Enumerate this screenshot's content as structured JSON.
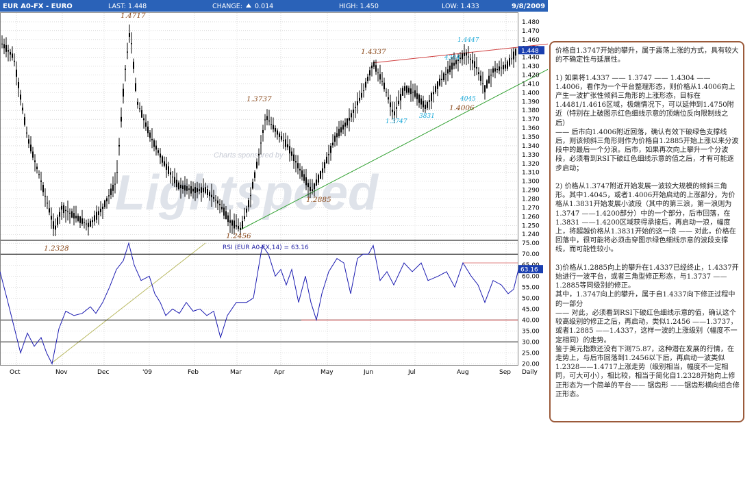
{
  "header": {
    "symbol": "EUR A0-FX - EURO",
    "last": "LAST: 1.448",
    "change_label": "CHANGE:",
    "change_value": "0.014",
    "high": "HIGH: 1.450",
    "low": "LOW: 1.433",
    "date": "9/8/2009"
  },
  "chart_data": [
    {
      "type": "candlestick",
      "title": "EUR A0-FX - EURO",
      "y_ticks": [
        "1.480",
        "1.470",
        "1.460",
        "1.450",
        "1.440",
        "1.430",
        "1.420",
        "1.410",
        "1.400",
        "1.390",
        "1.380",
        "1.370",
        "1.360",
        "1.350",
        "1.340",
        "1.330",
        "1.320",
        "1.310",
        "1.300",
        "1.290",
        "1.280",
        "1.270",
        "1.260",
        "1.250",
        "1.240"
      ],
      "ylim": [
        1.234,
        1.49
      ],
      "last_value_label": "1.448",
      "x_ticks": [
        "Oct",
        "Nov",
        "Dec",
        "'09",
        "Feb",
        "Mar",
        "Apr",
        "May",
        "Jun",
        "Jul",
        "Aug",
        "Sep",
        "Daily"
      ],
      "price_path": [
        [
          0,
          1.458
        ],
        [
          20,
          1.44
        ],
        [
          40,
          1.35
        ],
        [
          60,
          1.3
        ],
        [
          80,
          1.245
        ],
        [
          90,
          1.27
        ],
        [
          110,
          1.26
        ],
        [
          130,
          1.25
        ],
        [
          150,
          1.27
        ],
        [
          170,
          1.3
        ],
        [
          182,
          1.42
        ],
        [
          190,
          1.4717
        ],
        [
          200,
          1.39
        ],
        [
          220,
          1.35
        ],
        [
          240,
          1.32
        ],
        [
          260,
          1.295
        ],
        [
          280,
          1.29
        ],
        [
          300,
          1.29
        ],
        [
          320,
          1.275
        ],
        [
          335,
          1.255
        ],
        [
          352,
          1.2456
        ],
        [
          365,
          1.28
        ],
        [
          378,
          1.33
        ],
        [
          388,
          1.3737
        ],
        [
          400,
          1.36
        ],
        [
          420,
          1.34
        ],
        [
          440,
          1.31
        ],
        [
          455,
          1.2885
        ],
        [
          470,
          1.31
        ],
        [
          490,
          1.35
        ],
        [
          510,
          1.37
        ],
        [
          530,
          1.4
        ],
        [
          545,
          1.4337
        ],
        [
          560,
          1.41
        ],
        [
          575,
          1.3747
        ],
        [
          590,
          1.405
        ],
        [
          605,
          1.4
        ],
        [
          622,
          1.3831
        ],
        [
          640,
          1.41
        ],
        [
          660,
          1.43
        ],
        [
          680,
          1.4447
        ],
        [
          695,
          1.43
        ],
        [
          708,
          1.4045
        ],
        [
          720,
          1.425
        ],
        [
          740,
          1.43
        ],
        [
          755,
          1.448
        ]
      ],
      "annotations": [
        {
          "text": "1.4717",
          "style": "wave"
        },
        {
          "text": "1.3737",
          "style": "wave"
        },
        {
          "text": "1.4337",
          "style": "wave"
        },
        {
          "text": "1.4447",
          "style": "wave-b"
        },
        {
          "text": "4304",
          "style": "wave-b"
        },
        {
          "text": "1.4006",
          "style": "wave"
        },
        {
          "text": "4045",
          "style": "wave-b"
        },
        {
          "text": "3831",
          "style": "wave-b"
        },
        {
          "text": "1.3747",
          "style": "wave-b"
        },
        {
          "text": "1.2885",
          "style": "wave"
        },
        {
          "text": "1.2456",
          "style": "wave"
        },
        {
          "text": "1.2328",
          "style": "wave"
        }
      ],
      "watermark": [
        "Charts sponsored by",
        "Lightspeed"
      ],
      "trendlines": [
        {
          "color": "#d04040",
          "from": [
            545,
            1.4337
          ],
          "to": [
            800,
            1.455
          ]
        },
        {
          "color": "#30a030",
          "from": [
            352,
            1.2456
          ],
          "to": [
            800,
            1.4263
          ]
        }
      ]
    },
    {
      "type": "line",
      "title": "RSI (EUR A0-FX,14) = 63.16",
      "series": [
        {
          "name": "RSI (EUR A0-FX,14)",
          "color": "#1a1ab0"
        }
      ],
      "y_ticks": [
        "75.00",
        "70.00",
        "65.00",
        "60.00",
        "55.00",
        "50.00",
        "45.00",
        "40.00",
        "35.00",
        "30.00",
        "25.00",
        "20.00"
      ],
      "ylim": [
        19.5,
        76
      ],
      "last_value_label": "63.16",
      "rsi_path": [
        [
          0,
          62
        ],
        [
          10,
          50
        ],
        [
          22,
          35
        ],
        [
          30,
          25
        ],
        [
          40,
          34
        ],
        [
          50,
          28
        ],
        [
          60,
          32
        ],
        [
          68,
          25
        ],
        [
          76,
          20
        ],
        [
          86,
          36
        ],
        [
          96,
          44
        ],
        [
          108,
          42
        ],
        [
          120,
          43
        ],
        [
          132,
          46
        ],
        [
          140,
          43
        ],
        [
          150,
          48
        ],
        [
          160,
          55
        ],
        [
          170,
          63
        ],
        [
          180,
          67
        ],
        [
          188,
          75
        ],
        [
          196,
          65
        ],
        [
          206,
          58
        ],
        [
          218,
          60
        ],
        [
          226,
          52
        ],
        [
          234,
          48
        ],
        [
          242,
          42
        ],
        [
          252,
          45
        ],
        [
          262,
          43
        ],
        [
          272,
          48
        ],
        [
          282,
          44
        ],
        [
          292,
          45
        ],
        [
          302,
          42
        ],
        [
          312,
          44
        ],
        [
          322,
          32
        ],
        [
          332,
          42
        ],
        [
          345,
          48
        ],
        [
          360,
          48
        ],
        [
          370,
          50
        ],
        [
          383,
          74
        ],
        [
          392,
          70
        ],
        [
          402,
          60
        ],
        [
          410,
          63
        ],
        [
          418,
          56
        ],
        [
          426,
          63
        ],
        [
          436,
          48
        ],
        [
          446,
          60
        ],
        [
          454,
          48
        ],
        [
          462,
          40
        ],
        [
          470,
          52
        ],
        [
          480,
          62
        ],
        [
          492,
          68
        ],
        [
          502,
          66
        ],
        [
          512,
          52
        ],
        [
          522,
          68
        ],
        [
          530,
          70
        ],
        [
          538,
          70
        ],
        [
          545,
          74
        ],
        [
          555,
          58
        ],
        [
          565,
          62
        ],
        [
          575,
          56
        ],
        [
          590,
          66
        ],
        [
          602,
          62
        ],
        [
          615,
          66
        ],
        [
          625,
          58
        ],
        [
          640,
          60
        ],
        [
          652,
          62
        ],
        [
          664,
          55
        ],
        [
          676,
          66
        ],
        [
          688,
          60
        ],
        [
          698,
          56
        ],
        [
          708,
          48
        ],
        [
          720,
          58
        ],
        [
          732,
          56
        ],
        [
          742,
          52
        ],
        [
          750,
          54
        ],
        [
          757,
          63
        ]
      ],
      "hlines": [
        {
          "value": 70,
          "color": "#000000"
        },
        {
          "value": 40,
          "color": "#000000"
        },
        {
          "value": 30,
          "color": "#000000"
        },
        {
          "value": 40,
          "color": "#d04040",
          "x_from": 440
        },
        {
          "value": 66,
          "color": "#e08080",
          "x_from": 676
        }
      ]
    }
  ],
  "notes": {
    "text": "价格自1.3747开始的攀升，属于震荡上涨的方式，具有较大的不确定性与延展性。\n\n1) 如果将1.4337 —— 1.3747 —— 1.4304 —— 1.4006，看作为一个平台整理形态，则价格从1.4006向上产生一波扩张性倾斜三角形的上涨形态，目标在1.4481/1.4616区域，极端情况下，可以延伸到1.4750附近（特别在上破图示红色细线示意的顶端位反向限制线之后）\n—— 后市向1.4006附近回落，确认有效下破绿色支撑线后，则该倾斜三角形则作为价格自1.2885开始上涨以来分波段中的最后一个分浪。后市，如果再次向上攀升一个分波段，必须看到RSI下破红色细线示意的值之后，才有可能逐步启动；\n\n2) 价格从1.3747附近开始发展一波较大规模的倾斜三角形。其中1.4045，或者1.4006开始启动的上涨部分，为价格从1.3831开始发展小波段（其中的第三浪，第一浪则为1.3747 ——1.4200部分）中的一个部分，后市回落，在1.3831 ——1.4200区域获得承接后，再启动一浪，幅度上，将超越价格从1.3831开始的这一浪 —— 对此，价格在回落中，很可能将必须击穿图示绿色细线示意的波段支撑线，而可能性较小。\n\n3)价格从1.2885向上的攀升在1.4337已经终止，1.4337开始进行一波平台，或者三角型修正形态，与1.3737 —— 1.2885等同级别的修正。\n其中，1.3747向上的攀升，属于自1.4337向下修正过程中的一部分\n—— 对此，必须看到RSI下破红色细线示意的值，确认这个较高级别的修正之后，再启动，类似1.2456 ——1.3737，或者1.2885 ——1.4337，这样一波的上涨级别（幅度不一定相同）的走势。\n鉴于美元指数还没有下测75.87，这种潜在发展的行情，在走势上，与后市回落到1.2456以下后，再启动一波类似1.2328——1.4717上涨走势（级别相当，幅度不一定相同，可大可小），相比较，相当于简化自1.2328开始向上修正形态为一个简单的平台—— 锯齿形 ——锯齿形横向组合修正形态。"
  },
  "colors": {
    "header_bg": "#2a62b8",
    "grid": "#c8c8c8",
    "candle": "#000000",
    "rsi": "#1a1ab0",
    "resistance": "#d04040",
    "support": "#30a030",
    "annotation": "#8b4a1c",
    "annotation_alt": "#18a8d8",
    "notes_border": "#9b5a3a"
  }
}
